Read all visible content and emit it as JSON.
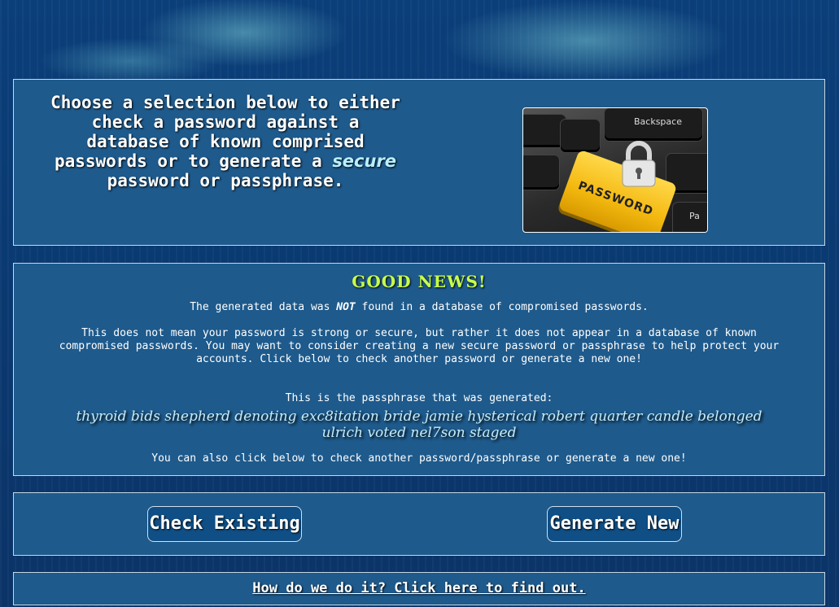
{
  "intro": {
    "text_before": "Choose a selection below to either check a password against a database of known comprised passwords or to generate a ",
    "emphasis": "secure",
    "text_after": " password or passphrase."
  },
  "image": {
    "key_label": "PASSWORD",
    "backspace_label": "Backspace",
    "pa_label": "Pa",
    "icon": "padlock-icon"
  },
  "result": {
    "heading": "GOOD NEWS!",
    "line1_before": "The generated data was ",
    "line1_emphasis": "NOT",
    "line1_after": " found in a database of compromised passwords.",
    "line2": "This does not mean your password is strong or secure, but rather it does not appear in a database of known compromised passwords. You may want to consider creating a new secure password or passphrase to help protect your accounts. Click below to check another password or generate a new one!",
    "line3": "This is the passphrase that was generated:",
    "passphrase": "thyroid bids shepherd denoting exc8itation bride jamie hysterical robert quarter candle belonged ulrich voted nel7son staged",
    "line4": "You can also click below to check another password/passphrase or generate a new one!"
  },
  "buttons": {
    "check": "Check Existing",
    "generate": "Generate New"
  },
  "footer": {
    "link": "How do we do it? Click here to find out."
  },
  "colors": {
    "panel": "#1e5a8c",
    "good_news": "#c9ff4a",
    "passphrase": "#c7ecf6",
    "emphasis": "#b9f0ff"
  }
}
